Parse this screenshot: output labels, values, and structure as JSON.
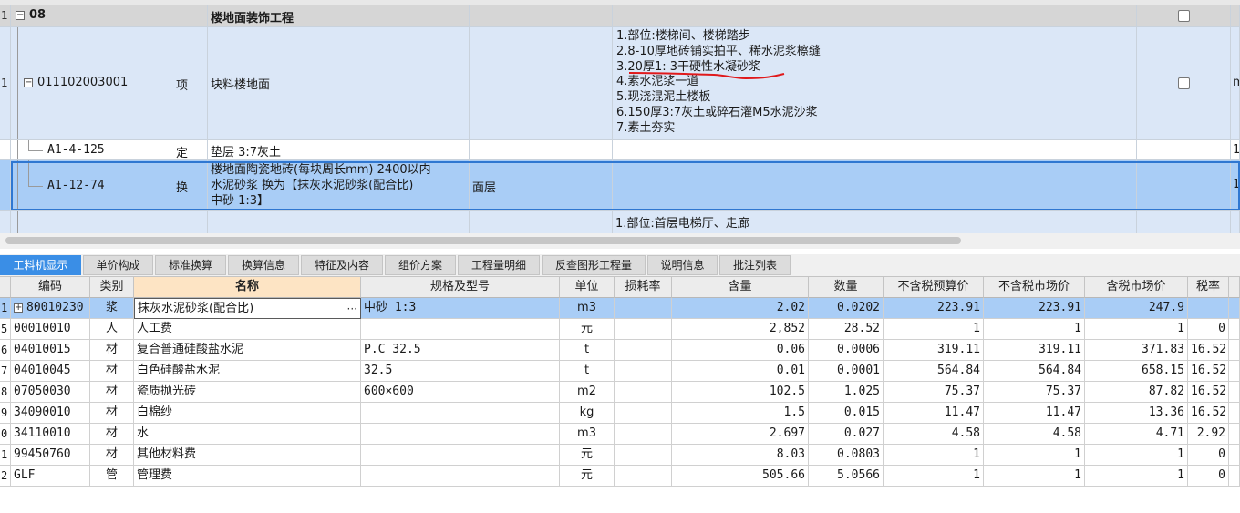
{
  "top_grid": {
    "rows": [
      {
        "num": "1",
        "code": "08",
        "type": "",
        "name": "楼地面装饰工程",
        "tag": "",
        "desc": ""
      },
      {
        "num": "1",
        "code": "011102003001",
        "type": "项",
        "name": "块料楼地面",
        "tag": "",
        "desc_lines": [
          "1.部位:楼梯间、楼梯踏步",
          "2.8-10厚地砖铺实拍平、稀水泥浆檫缝",
          "3.20厚1: 3干硬性水凝砂浆",
          "4.素水泥浆一道",
          "5.现浇混泥土楼板",
          "6.150厚3:7灰土或碎石灌M5水泥沙浆",
          "7.素土夯实"
        ],
        "tail": "m"
      },
      {
        "num": "",
        "code": "A1-4-125",
        "type": "定",
        "name": "垫层 3:7灰土",
        "tag": "",
        "tail": "1"
      },
      {
        "num": "",
        "code": "A1-12-74",
        "type": "换",
        "name_lines": [
          "楼地面陶瓷地砖(每块周长mm) 2400以内",
          "水泥砂浆  换为【抹灰水泥砂浆(配合比)",
          "中砂 1:3】"
        ],
        "tag": "面层",
        "tail": "1"
      },
      {
        "num": "",
        "code": "",
        "type": "",
        "name": "",
        "tag": "",
        "desc_lines": [
          "1.部位:首层电梯厅、走廊"
        ]
      }
    ]
  },
  "tabs": [
    "工料机显示",
    "单价构成",
    "标准换算",
    "换算信息",
    "特征及内容",
    "组价方案",
    "工程量明细",
    "反查图形工程量",
    "说明信息",
    "批注列表"
  ],
  "bottom_grid": {
    "headers": [
      "编码",
      "类别",
      "名称",
      "规格及型号",
      "单位",
      "损耗率",
      "含量",
      "数量",
      "不含税预算价",
      "不含税市场价",
      "含税市场价",
      "税率"
    ],
    "rows": [
      {
        "num": "1",
        "code": "80010230",
        "cat": "浆",
        "name": "抹灰水泥砂浆(配合比)",
        "spec": "中砂 1:3",
        "unit": "m3",
        "loss": "",
        "content": "2.02",
        "qty": "0.0202",
        "budget": "223.91",
        "market": "223.91",
        "taxmarket": "247.9",
        "tax": ""
      },
      {
        "num": "5",
        "code": "00010010",
        "cat": "人",
        "name": "人工费",
        "spec": "",
        "unit": "元",
        "loss": "",
        "content": "2,852",
        "qty": "28.52",
        "budget": "1",
        "market": "1",
        "taxmarket": "1",
        "tax": "0"
      },
      {
        "num": "6",
        "code": "04010015",
        "cat": "材",
        "name": "复合普通硅酸盐水泥",
        "spec": "P.C 32.5",
        "unit": "t",
        "loss": "",
        "content": "0.06",
        "qty": "0.0006",
        "budget": "319.11",
        "market": "319.11",
        "taxmarket": "371.83",
        "tax": "16.52"
      },
      {
        "num": "7",
        "code": "04010045",
        "cat": "材",
        "name": "白色硅酸盐水泥",
        "spec": "32.5",
        "unit": "t",
        "loss": "",
        "content": "0.01",
        "qty": "0.0001",
        "budget": "564.84",
        "market": "564.84",
        "taxmarket": "658.15",
        "tax": "16.52"
      },
      {
        "num": "8",
        "code": "07050030",
        "cat": "材",
        "name": "瓷质抛光砖",
        "spec": "600×600",
        "unit": "m2",
        "loss": "",
        "content": "102.5",
        "qty": "1.025",
        "budget": "75.37",
        "market": "75.37",
        "taxmarket": "87.82",
        "tax": "16.52"
      },
      {
        "num": "9",
        "code": "34090010",
        "cat": "材",
        "name": "白棉纱",
        "spec": "",
        "unit": "kg",
        "loss": "",
        "content": "1.5",
        "qty": "0.015",
        "budget": "11.47",
        "market": "11.47",
        "taxmarket": "13.36",
        "tax": "16.52"
      },
      {
        "num": "0",
        "code": "34110010",
        "cat": "材",
        "name": "水",
        "spec": "",
        "unit": "m3",
        "loss": "",
        "content": "2.697",
        "qty": "0.027",
        "budget": "4.58",
        "market": "4.58",
        "taxmarket": "4.71",
        "tax": "2.92"
      },
      {
        "num": "1",
        "code": "99450760",
        "cat": "材",
        "name": "其他材料费",
        "spec": "",
        "unit": "元",
        "loss": "",
        "content": "8.03",
        "qty": "0.0803",
        "budget": "1",
        "market": "1",
        "taxmarket": "1",
        "tax": "0"
      },
      {
        "num": "2",
        "code": "GLF",
        "cat": "管",
        "name": "管理费",
        "spec": "",
        "unit": "元",
        "loss": "",
        "content": "505.66",
        "qty": "5.0566",
        "budget": "1",
        "market": "1",
        "taxmarket": "1",
        "tax": "0"
      }
    ]
  },
  "colors": {
    "selected_row": "#a9cdf6",
    "group_row": "#dbe7f7",
    "active_tab": "#3a8ee6",
    "name_header": "#fde4c4",
    "annotation": "#e0191b"
  }
}
